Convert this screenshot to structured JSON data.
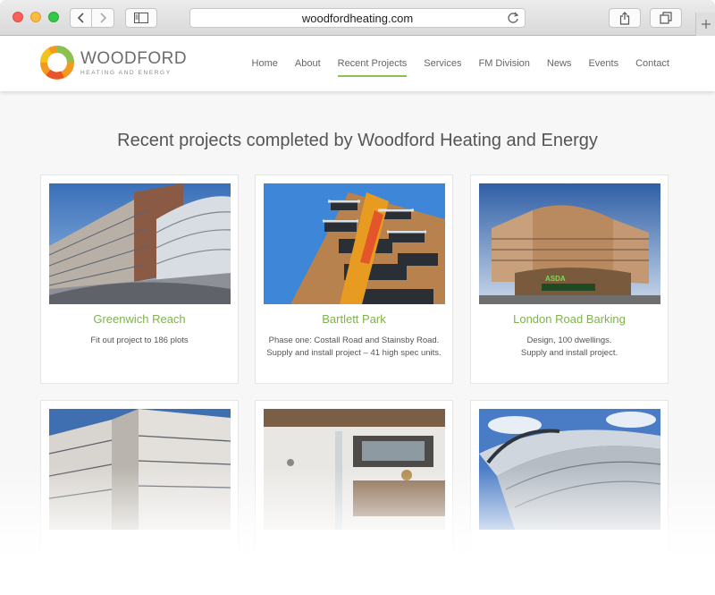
{
  "browser": {
    "url": "woodfordheating.com"
  },
  "logo": {
    "name": "WOODFORD",
    "tagline": "HEATING AND ENERGY"
  },
  "nav": {
    "items": [
      {
        "label": "Home",
        "active": false
      },
      {
        "label": "About",
        "active": false
      },
      {
        "label": "Recent Projects",
        "active": true
      },
      {
        "label": "Services",
        "active": false
      },
      {
        "label": "FM Division",
        "active": false
      },
      {
        "label": "News",
        "active": false
      },
      {
        "label": "Events",
        "active": false
      },
      {
        "label": "Contact",
        "active": false
      }
    ]
  },
  "page": {
    "title": "Recent projects completed by Woodford Heating and Energy"
  },
  "projects": [
    {
      "title": "Greenwich Reach",
      "desc_line1": "Fit out project to 186 plots",
      "desc_line2": ""
    },
    {
      "title": "Bartlett Park",
      "desc_line1": "Phase one: Costall Road and Stainsby Road.",
      "desc_line2": "Supply and install project – 41 high spec units."
    },
    {
      "title": "London Road Barking",
      "desc_line1": "Design, 100 dwellings.",
      "desc_line2": "Supply and install project."
    },
    {
      "title": "",
      "desc_line1": "",
      "desc_line2": ""
    },
    {
      "title": "",
      "desc_line1": "",
      "desc_line2": ""
    },
    {
      "title": "",
      "desc_line1": "",
      "desc_line2": ""
    }
  ],
  "store_sign": "ASDA",
  "colors": {
    "accent_green": "#8cc152",
    "title_green": "#7fb24d",
    "logo_orange": "#f39a1e",
    "logo_green": "#8cc152"
  }
}
